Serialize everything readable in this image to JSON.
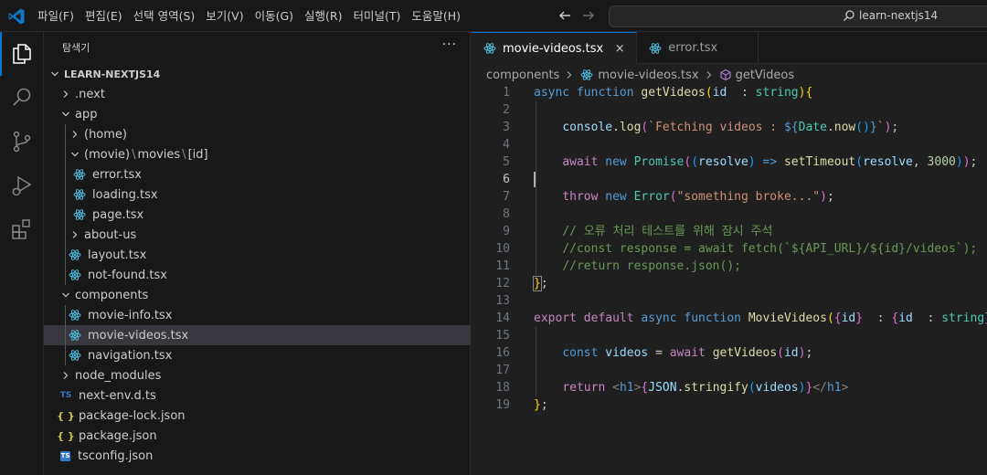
{
  "titlebar": {
    "menu": [
      "파일(F)",
      "편집(E)",
      "선택 영역(S)",
      "보기(V)",
      "이동(G)",
      "실행(R)",
      "터미널(T)",
      "도움말(H)"
    ],
    "search_text": "learn-nextjs14"
  },
  "activity_bar": [
    "explorer-icon",
    "search-icon",
    "source-control-icon",
    "run-debug-icon",
    "extensions-icon"
  ],
  "sidebar": {
    "title": "탐색기",
    "more": "···",
    "tree": [
      {
        "label": "LEARN-NEXTJS14",
        "kind": "root",
        "depth": 0,
        "expanded": true
      },
      {
        "label": ".next",
        "kind": "folder",
        "depth": 1,
        "expanded": false
      },
      {
        "label": "app",
        "kind": "folder",
        "depth": 1,
        "expanded": true
      },
      {
        "label": "(home)",
        "kind": "folder",
        "depth": 2,
        "expanded": false
      },
      {
        "label": "(movie)",
        "kind": "folder-compact",
        "depth": 2,
        "expanded": true,
        "parts": [
          "(movie)",
          "movies",
          "[id]"
        ]
      },
      {
        "label": "error.tsx",
        "kind": "react",
        "depth": 3
      },
      {
        "label": "loading.tsx",
        "kind": "react",
        "depth": 3
      },
      {
        "label": "page.tsx",
        "kind": "react",
        "depth": 3
      },
      {
        "label": "about-us",
        "kind": "folder",
        "depth": 2,
        "expanded": false
      },
      {
        "label": "layout.tsx",
        "kind": "react",
        "depth": 2
      },
      {
        "label": "not-found.tsx",
        "kind": "react",
        "depth": 2
      },
      {
        "label": "components",
        "kind": "folder",
        "depth": 1,
        "expanded": true
      },
      {
        "label": "movie-info.tsx",
        "kind": "react",
        "depth": 2
      },
      {
        "label": "movie-videos.tsx",
        "kind": "react",
        "depth": 2,
        "selected": true
      },
      {
        "label": "navigation.tsx",
        "kind": "react",
        "depth": 2
      },
      {
        "label": "node_modules",
        "kind": "folder",
        "depth": 1,
        "expanded": false
      },
      {
        "label": "next-env.d.ts",
        "kind": "ts",
        "depth": 1,
        "icon_text": "TS"
      },
      {
        "label": "package-lock.json",
        "kind": "json",
        "depth": 1,
        "icon_text": "{ }"
      },
      {
        "label": "package.json",
        "kind": "json",
        "depth": 1,
        "icon_text": "{ }"
      },
      {
        "label": "tsconfig.json",
        "kind": "tsconfig",
        "depth": 1,
        "icon_text": "TS"
      }
    ]
  },
  "editor": {
    "tabs": [
      {
        "label": "movie-videos.tsx",
        "active": true,
        "close": "×"
      },
      {
        "label": "error.tsx",
        "active": false
      }
    ],
    "breadcrumb": [
      "components",
      "movie-videos.tsx",
      "getVideos"
    ],
    "current_line": 6,
    "lines": [
      [
        [
          "kw",
          "async "
        ],
        [
          "kw",
          "function "
        ],
        [
          "fn",
          "getVideos"
        ],
        [
          "b1",
          "("
        ],
        [
          "var",
          "id"
        ],
        [
          "",
          "  : "
        ],
        [
          "cls",
          "string"
        ],
        [
          "b1",
          ")"
        ],
        [
          "b1",
          "{"
        ]
      ],
      [],
      [
        [
          "",
          "    "
        ],
        [
          "var",
          "console"
        ],
        [
          "",
          "."
        ],
        [
          "fn",
          "log"
        ],
        [
          "b2",
          "("
        ],
        [
          "str",
          "`Fetching videos : "
        ],
        [
          "kw",
          "${"
        ],
        [
          "cls",
          "Date"
        ],
        [
          "",
          "."
        ],
        [
          "fn",
          "now"
        ],
        [
          "b3",
          "()"
        ],
        [
          "kw",
          "}"
        ],
        [
          "str",
          "`"
        ],
        [
          "b2",
          ")"
        ],
        [
          "",
          ";"
        ]
      ],
      [],
      [
        [
          "",
          "    "
        ],
        [
          "kw2",
          "await "
        ],
        [
          "kw",
          "new "
        ],
        [
          "cls",
          "Promise"
        ],
        [
          "b2",
          "("
        ],
        [
          "b3",
          "("
        ],
        [
          "var",
          "resolve"
        ],
        [
          "b3",
          ")"
        ],
        [
          "kw",
          " => "
        ],
        [
          "fn",
          "setTimeout"
        ],
        [
          "b3",
          "("
        ],
        [
          "var",
          "resolve"
        ],
        [
          "",
          ", "
        ],
        [
          "num",
          "3000"
        ],
        [
          "b3",
          ")"
        ],
        [
          "b2",
          ")"
        ],
        [
          "",
          ";"
        ]
      ],
      [],
      [
        [
          "",
          "    "
        ],
        [
          "kw2",
          "throw "
        ],
        [
          "kw",
          "new "
        ],
        [
          "cls",
          "Error"
        ],
        [
          "b2",
          "("
        ],
        [
          "str",
          "\"something broke...\""
        ],
        [
          "b2",
          ")"
        ],
        [
          "",
          ";"
        ]
      ],
      [],
      [
        [
          "",
          "    "
        ],
        [
          "cmt",
          "// 오류 처리 테스트를 위해 잠시 주석"
        ]
      ],
      [
        [
          "",
          "    "
        ],
        [
          "cmt",
          "//const response = await fetch(`${API_URL}/${id}/videos`);"
        ]
      ],
      [
        [
          "",
          "    "
        ],
        [
          "cmt",
          "//return response.json();"
        ]
      ],
      [
        [
          "b1bm",
          "}"
        ],
        [
          "",
          ";"
        ]
      ],
      [],
      [
        [
          "kw2",
          "export "
        ],
        [
          "kw2",
          "default "
        ],
        [
          "kw",
          "async "
        ],
        [
          "kw",
          "function "
        ],
        [
          "fn",
          "MovieVideos"
        ],
        [
          "b1",
          "("
        ],
        [
          "b2",
          "{"
        ],
        [
          "var",
          "id"
        ],
        [
          "b2",
          "}"
        ],
        [
          "",
          "  : "
        ],
        [
          "b2",
          "{"
        ],
        [
          "var",
          "id"
        ],
        [
          "",
          "  : "
        ],
        [
          "cls",
          "string"
        ],
        [
          "b2",
          "}"
        ],
        [
          "b1",
          ")"
        ],
        [
          "b1",
          "{"
        ]
      ],
      [],
      [
        [
          "",
          "    "
        ],
        [
          "kw",
          "const "
        ],
        [
          "var",
          "videos"
        ],
        [
          "",
          ""
        ],
        [
          "",
          " = "
        ],
        [
          "kw2",
          "await "
        ],
        [
          "fn",
          "getVideos"
        ],
        [
          "b2",
          "("
        ],
        [
          "var",
          "id"
        ],
        [
          "b2",
          ")"
        ],
        [
          "",
          ";"
        ]
      ],
      [],
      [
        [
          "",
          "    "
        ],
        [
          "kw2",
          "return "
        ],
        [
          "tag",
          "<"
        ],
        [
          "kw",
          "h1"
        ],
        [
          "tag",
          ">"
        ],
        [
          "b2",
          "{"
        ],
        [
          "var",
          "JSON"
        ],
        [
          "",
          "."
        ],
        [
          "fn",
          "stringify"
        ],
        [
          "b3",
          "("
        ],
        [
          "var",
          "videos"
        ],
        [
          "b3",
          ")"
        ],
        [
          "b2",
          "}"
        ],
        [
          "tag",
          "</"
        ],
        [
          "kw",
          "h1"
        ],
        [
          "tag",
          ">"
        ]
      ],
      [
        [
          "b1",
          "}"
        ],
        [
          "",
          ";"
        ]
      ]
    ]
  },
  "colors": {
    "accent": "#0078d4",
    "react_icon": "#4fb6d4",
    "ts_blue": "#3178c6",
    "json_yellow": "#cbcb41"
  }
}
